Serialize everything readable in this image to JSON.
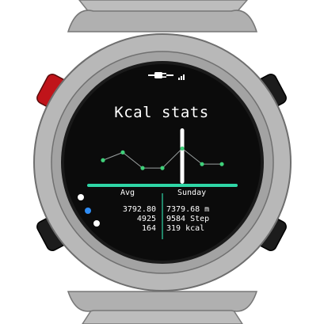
{
  "screen": {
    "title": "Kcal stats",
    "status_icons": [
      "plug-icon",
      "signal-bars-icon"
    ]
  },
  "columns": {
    "left_header": "Avg",
    "right_header": "Sunday"
  },
  "stats": {
    "avg": {
      "distance": "3792.80",
      "steps": "4925",
      "kcal": "164"
    },
    "day": {
      "distance": "7379.68 m",
      "steps": "9584 Step",
      "kcal": "319 kcal"
    }
  },
  "page_indicator": {
    "total": 3,
    "active_index": 1
  },
  "colors": {
    "accent": "#2fd6a6",
    "point": "#3fd07a",
    "screen": "#0b0b0b",
    "bezel": "#9c9c9c",
    "case": "#b5b5b5",
    "red_button": "#c0141a",
    "dot_active": "#2f8df5"
  },
  "chart_data": {
    "type": "line",
    "title": "",
    "xlabel": "",
    "ylabel": "",
    "values": [
      4,
      6,
      2,
      2,
      7,
      3,
      3
    ],
    "selected_index": 4,
    "ylim": [
      0,
      10
    ]
  }
}
